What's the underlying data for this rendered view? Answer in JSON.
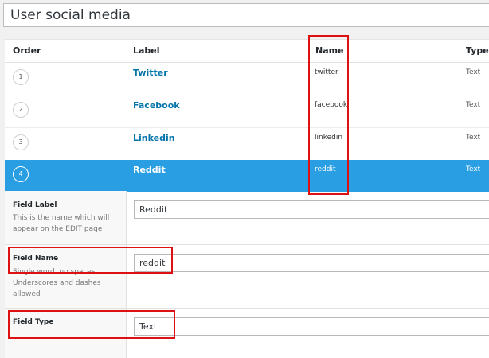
{
  "page_title": "User social media",
  "table": {
    "headers": [
      "Order",
      "Label",
      "Name",
      "Type"
    ],
    "rows": [
      {
        "order": "1",
        "label": "Twitter",
        "name": "twitter",
        "type": "Text"
      },
      {
        "order": "2",
        "label": "Facebook",
        "name": "facebook",
        "type": "Text"
      },
      {
        "order": "3",
        "label": "Linkedin",
        "name": "linkedin",
        "type": "Text"
      },
      {
        "order": "4",
        "label": "Reddit",
        "name": "reddit",
        "type": "Text"
      }
    ]
  },
  "settings": {
    "field_label": {
      "title": "Field Label",
      "desc": "This is the name which will appear on the EDIT page",
      "value": "Reddit"
    },
    "field_name": {
      "title": "Field Name",
      "desc": "Single word, no spaces. Underscores and dashes allowed",
      "value": "reddit"
    },
    "field_type": {
      "title": "Field Type",
      "value": "Text"
    }
  },
  "colors": {
    "active_row": "#2a9ee3",
    "link": "#0073aa",
    "highlight_box": "#dd1111"
  }
}
